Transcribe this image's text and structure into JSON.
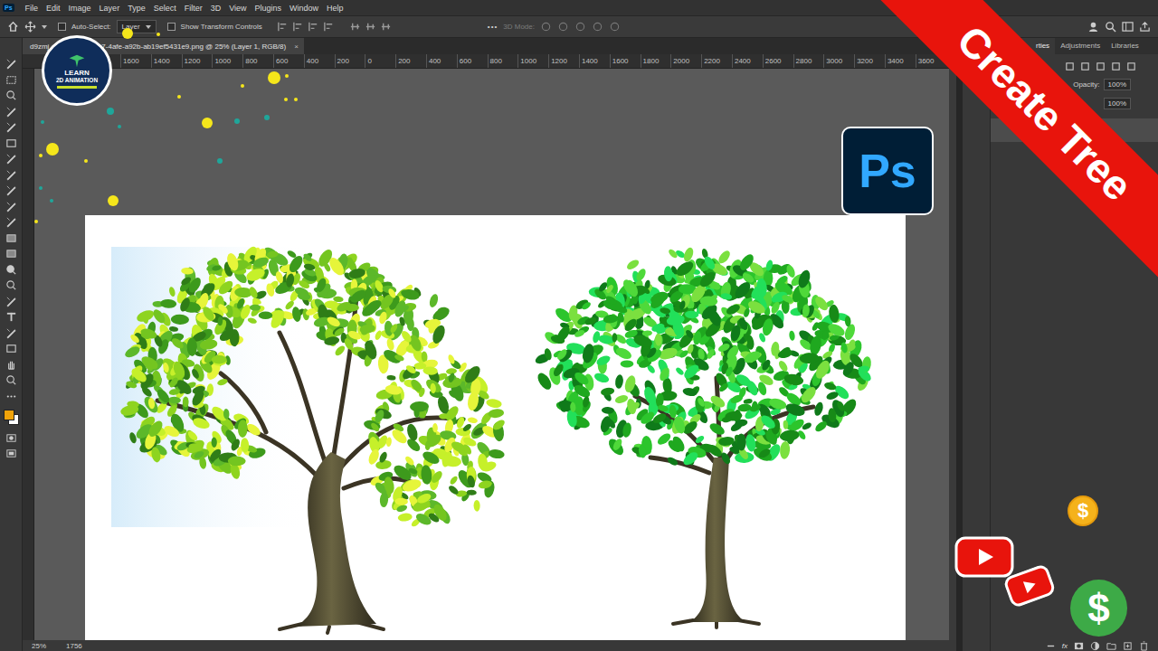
{
  "app": {
    "logo": "Ps"
  },
  "menu": [
    "File",
    "Edit",
    "Image",
    "Layer",
    "Type",
    "Select",
    "Filter",
    "3D",
    "View",
    "Plugins",
    "Window",
    "Help"
  ],
  "options_bar": {
    "auto_select_label": "Auto-Select:",
    "auto_select_checked": false,
    "layer_dropdown": "Layer",
    "transform_label": "Show Transform Controls",
    "transform_checked": false,
    "more": "•••",
    "mode_3d": "3D Mode:"
  },
  "document_tab": {
    "title_start": "d9zmj",
    "title_end": "7-4afe-a92b-ab19ef5431e9.png @ 25% (Layer 1, RGB/8)",
    "close": "×"
  },
  "ruler": {
    "ticks": [
      "1600",
      "1400",
      "1200",
      "1000",
      "800",
      "600",
      "400",
      "200",
      "0",
      "200",
      "400",
      "600",
      "800",
      "1000",
      "1200",
      "1400",
      "1600",
      "1800",
      "2000",
      "2200",
      "2400",
      "2600",
      "2800",
      "3000",
      "3200",
      "3400",
      "3600"
    ]
  },
  "panels": {
    "tabs": [
      {
        "label": "rties",
        "selected": true
      },
      {
        "label": "Adjustments",
        "selected": false
      },
      {
        "label": "Libraries",
        "selected": false
      }
    ],
    "opacity_label": "Opacity:",
    "opacity": "100%",
    "fill": "100%",
    "footer_fx": "fx"
  },
  "status_bar": {
    "zoom": "25%",
    "info": "1756"
  },
  "thumbnail": {
    "channel_logo": {
      "line1": "LEARN",
      "line2": "2D ANIMATION"
    },
    "app_badge": "Ps",
    "banner": "Create Tree",
    "coin": "$",
    "dollar": "$"
  }
}
